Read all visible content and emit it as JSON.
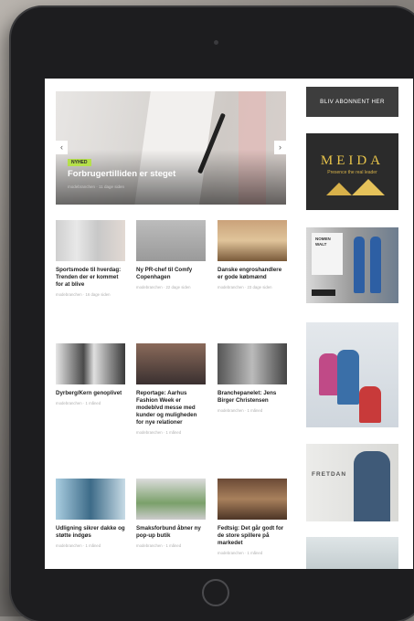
{
  "hero": {
    "tag": "NYHED",
    "title": "Forbrugertilliden er steget",
    "meta": "modebranchen · 11 dage siden",
    "prev_arrow": "‹",
    "next_arrow": "›"
  },
  "articles": [
    {
      "title": "Sportsmode til hverdag: Trenden der er kommet for at blive",
      "meta": "modebranchen · 16 dage siden"
    },
    {
      "title": "Ny PR-chef til Comfy Copenhagen",
      "meta": "modebranchen · 22 dage siden"
    },
    {
      "title": "Danske engroshandlere er gode købmænd",
      "meta": "modebranchen · 23 dage siden"
    },
    {
      "title": "Dyrberg/Kern genoplivet",
      "meta": "modebranchen · 1 måned"
    },
    {
      "title": "Reportage: Aarhus Fashion Week er modeblvd messe med kunder og muligheden for nye relationer",
      "meta": "modebranchen · 1 måned"
    },
    {
      "title": "Branchepanelet: Jens Birger Christensen",
      "meta": "modebranchen · 1 måned"
    },
    {
      "title": "Udligning sikrer dakke og støtte indgøs",
      "meta": "modebranchen · 1 måned"
    },
    {
      "title": "Smaksforbund åbner ny pop-up butik",
      "meta": "modebranchen · 1 måned"
    },
    {
      "title": "Fedtsig: Det går godt for de store spillere på markedet",
      "meta": "modebranchen · 1 måned"
    }
  ],
  "sidebar": {
    "subscribe_label": "BLIV ABONNENT HER",
    "meida_logo": "MEIDA",
    "meida_tagline": "Presence the real leader",
    "ad2_text": "NOMEN WALT",
    "ad4_brand": "FRETDAN"
  },
  "colors": {
    "accent_green": "#b5e04a",
    "button_dark": "#3d3d3d",
    "meida_gold": "#e8c44a"
  }
}
